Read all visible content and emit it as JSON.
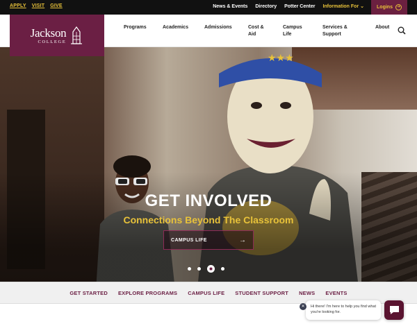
{
  "quick_links": [
    "APPLY",
    "VISIT",
    "GIVE"
  ],
  "utility_links": [
    "News & Events",
    "Directory",
    "Potter Center"
  ],
  "information_for": "Information For",
  "logins": "Logins",
  "logo": {
    "name": "Jackson",
    "sub": "COLLEGE"
  },
  "nav": [
    {
      "label": "Programs"
    },
    {
      "label": "Academics"
    },
    {
      "label": "Admissions"
    },
    {
      "label": "Cost & Aid"
    },
    {
      "label": "Campus Life"
    },
    {
      "label": "Services & Support"
    },
    {
      "label": "About"
    }
  ],
  "hero": {
    "title": "GET INVOLVED",
    "subtitle": "Connections Beyond The Classroom",
    "cta": "CAMPUS LIFE",
    "slide_count": 4,
    "active_slide": 3
  },
  "tabs": [
    "GET STARTED",
    "EXPLORE PROGRAMS",
    "CAMPUS LIFE",
    "STUDENT SUPPORT",
    "NEWS",
    "EVENTS"
  ],
  "chat": {
    "message": "Hi there! I'm here to help you find what you're looking for."
  },
  "colors": {
    "maroon": "#6b1f44",
    "gold": "#e8c23a",
    "topbar": "#111111"
  }
}
